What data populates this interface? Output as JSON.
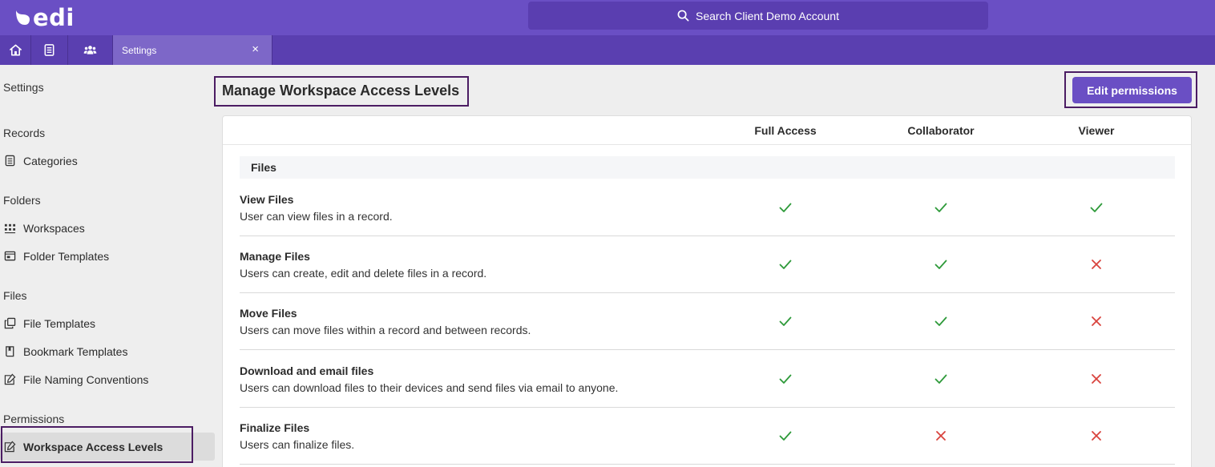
{
  "app": {
    "logo_text": "edi"
  },
  "search": {
    "label": "Search Client Demo Account"
  },
  "tabs": {
    "active_label": "Settings",
    "close_glyph": "×"
  },
  "sidebar": {
    "settings_heading": "Settings",
    "records_heading": "Records",
    "categories": "Categories",
    "folders_heading": "Folders",
    "workspaces": "Workspaces",
    "folder_templates": "Folder Templates",
    "files_heading": "Files",
    "file_templates": "File Templates",
    "bookmark_templates": "Bookmark Templates",
    "file_naming": "File Naming Conventions",
    "permissions_heading": "Permissions",
    "workspace_access_levels": "Workspace Access Levels"
  },
  "main": {
    "title": "Manage Workspace Access Levels",
    "edit_button": "Edit permissions",
    "columns": [
      "Full Access",
      "Collaborator",
      "Viewer"
    ],
    "section": "Files",
    "rows": [
      {
        "title": "View Files",
        "desc": "User can view files in a record.",
        "access": [
          true,
          true,
          true
        ]
      },
      {
        "title": "Manage Files",
        "desc": "Users can create, edit and delete files in a record.",
        "access": [
          true,
          true,
          false
        ]
      },
      {
        "title": "Move Files",
        "desc": "Users can move files within a record and between records.",
        "access": [
          true,
          true,
          false
        ]
      },
      {
        "title": "Download and email files",
        "desc": "Users can download files to their devices and send files via email to anyone.",
        "access": [
          true,
          true,
          false
        ]
      },
      {
        "title": "Finalize Files",
        "desc": "Users can finalize files.",
        "access": [
          true,
          false,
          false
        ]
      }
    ]
  },
  "colors": {
    "brand": "#6a4fc4",
    "check": "#2e9a3a",
    "cross": "#d9433d",
    "highlight": "#4b1c63"
  }
}
